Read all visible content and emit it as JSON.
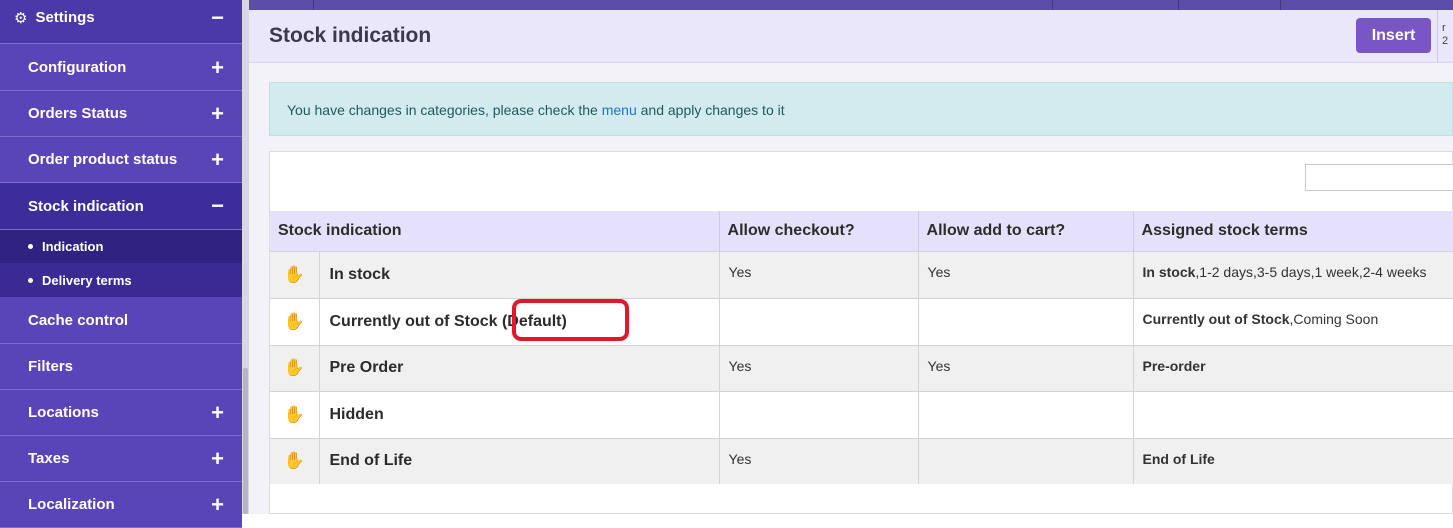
{
  "sidebar": {
    "header": {
      "label": "Settings",
      "icon": "gears-icon",
      "toggle": "−"
    },
    "items": [
      {
        "label": "Configuration",
        "toggle": "+"
      },
      {
        "label": "Orders Status",
        "toggle": "+"
      },
      {
        "label": "Order product status",
        "toggle": "+"
      },
      {
        "label": "Stock indication",
        "toggle": "−"
      }
    ],
    "subitems": [
      {
        "label": "Indication"
      },
      {
        "label": "Delivery terms"
      }
    ],
    "items_after": [
      {
        "label": "Cache control",
        "toggle": ""
      },
      {
        "label": "Filters",
        "toggle": ""
      },
      {
        "label": "Locations",
        "toggle": "+"
      },
      {
        "label": "Taxes",
        "toggle": "+"
      },
      {
        "label": "Localization",
        "toggle": "+"
      }
    ]
  },
  "page": {
    "title": "Stock indication",
    "insert_label": "Insert",
    "header_right_text": "r 2"
  },
  "alert": {
    "text_before": "You have changes in categories, please check the ",
    "link": "menu",
    "text_after": " and apply changes to it"
  },
  "table": {
    "columns": [
      "Stock indication",
      "Allow checkout?",
      "Allow add to cart?",
      "Assigned stock terms"
    ],
    "rows": [
      {
        "name": "In stock",
        "checkout": "Yes",
        "cart": "Yes",
        "terms_bold": "In stock",
        "terms_rest": ",1-2 days,3-5 days,1 week,2-4 weeks"
      },
      {
        "name": "Currently out of Stock (Default)",
        "checkout": "",
        "cart": "",
        "terms_bold": "Currently out of Stock",
        "terms_rest": ",Coming Soon"
      },
      {
        "name": "Pre Order",
        "checkout": "Yes",
        "cart": "Yes",
        "terms_bold": "Pre-order",
        "terms_rest": ""
      },
      {
        "name": "Hidden",
        "checkout": "",
        "cart": "",
        "terms_bold": "",
        "terms_rest": ""
      },
      {
        "name": "End of Life",
        "checkout": "Yes",
        "cart": "",
        "terms_bold": "End of Life",
        "terms_rest": ""
      }
    ]
  },
  "colors": {
    "sidebar": "#5a45b8",
    "sidebar_active": "#3d2d9a",
    "accent_button": "#7a55c6",
    "highlight_box": "#e0182a"
  }
}
